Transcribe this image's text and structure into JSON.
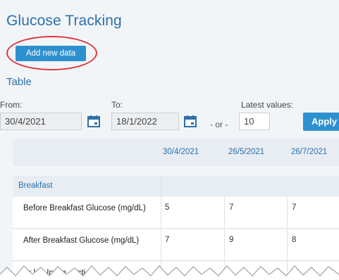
{
  "page": {
    "title": "Glucose Tracking"
  },
  "actions": {
    "add_new_data": "Add new data"
  },
  "table_section": {
    "title": "Table"
  },
  "filters": {
    "from_label": "From:",
    "from_value": "30/4/2021",
    "to_label": "To:",
    "to_value": "18/1/2022",
    "or_text": "- or -",
    "latest_label": "Latest values:",
    "latest_value": "10",
    "apply_label": "Apply"
  },
  "table": {
    "columns": [
      "30/4/2021",
      "26/5/2021",
      "26/7/2021"
    ],
    "group": "Breakfast",
    "rows": [
      {
        "label": "Before Breakfast Glucose (mg/dL)",
        "values": [
          "5",
          "7",
          "7"
        ]
      },
      {
        "label": "After Breakfast Glucose (mg/dL)",
        "values": [
          "7",
          "9",
          "8"
        ]
      },
      {
        "label": "Br  kfa  Ins  in  ...  cti",
        "values": [
          "",
          "",
          ""
        ]
      }
    ]
  },
  "colors": {
    "accent": "#2e91cf",
    "title_blue": "#2d6fa8",
    "highlight": "#e0363a",
    "background": "#f2f5f8",
    "header_bg": "#e7edf3"
  },
  "icons": {
    "calendar": "calendar-icon"
  }
}
